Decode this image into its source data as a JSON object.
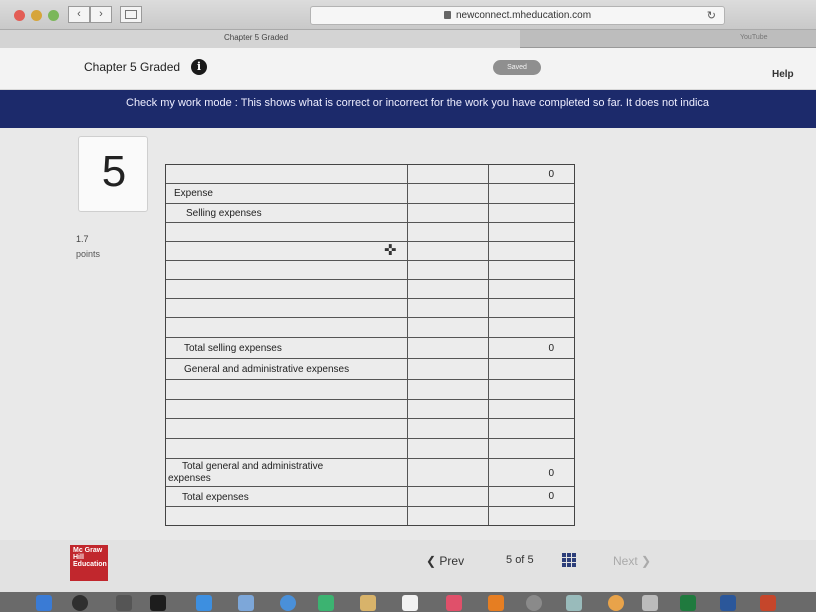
{
  "browser": {
    "url": "newconnect.mheducation.com",
    "tab_title": "Chapter 5 Graded",
    "second_tab": "YouTube"
  },
  "header": {
    "title": "Chapter 5 Graded",
    "info_icon": "info-icon",
    "saved_label": "Saved",
    "help_label": "Help"
  },
  "banner": {
    "text": "Check my work mode : This shows what is correct or incorrect for the work you have completed so far. It does not indica"
  },
  "question": {
    "number": "5",
    "points_value": "1.7",
    "points_label": "points"
  },
  "worksheet": {
    "top_value": "0",
    "expense_heading": "Expense",
    "selling_heading": "Selling expenses",
    "total_selling_label": "Total selling expenses",
    "total_selling_value": "0",
    "ga_heading": "General and administrative expenses",
    "total_ga_label_line1": "Total general and administrative",
    "total_ga_label_line2": "expenses",
    "total_ga_value": "0",
    "total_expenses_label": "Total expenses",
    "total_expenses_value": "0"
  },
  "footer": {
    "logo_text": "Mc Graw Hill Education",
    "prev_label": "Prev",
    "page_current": "5",
    "page_of": "of",
    "page_total": "5",
    "next_label": "Next"
  },
  "colors": {
    "banner": "#1c2a6b",
    "logo": "#c1272d",
    "saved_badge": "#8f8f8f"
  }
}
